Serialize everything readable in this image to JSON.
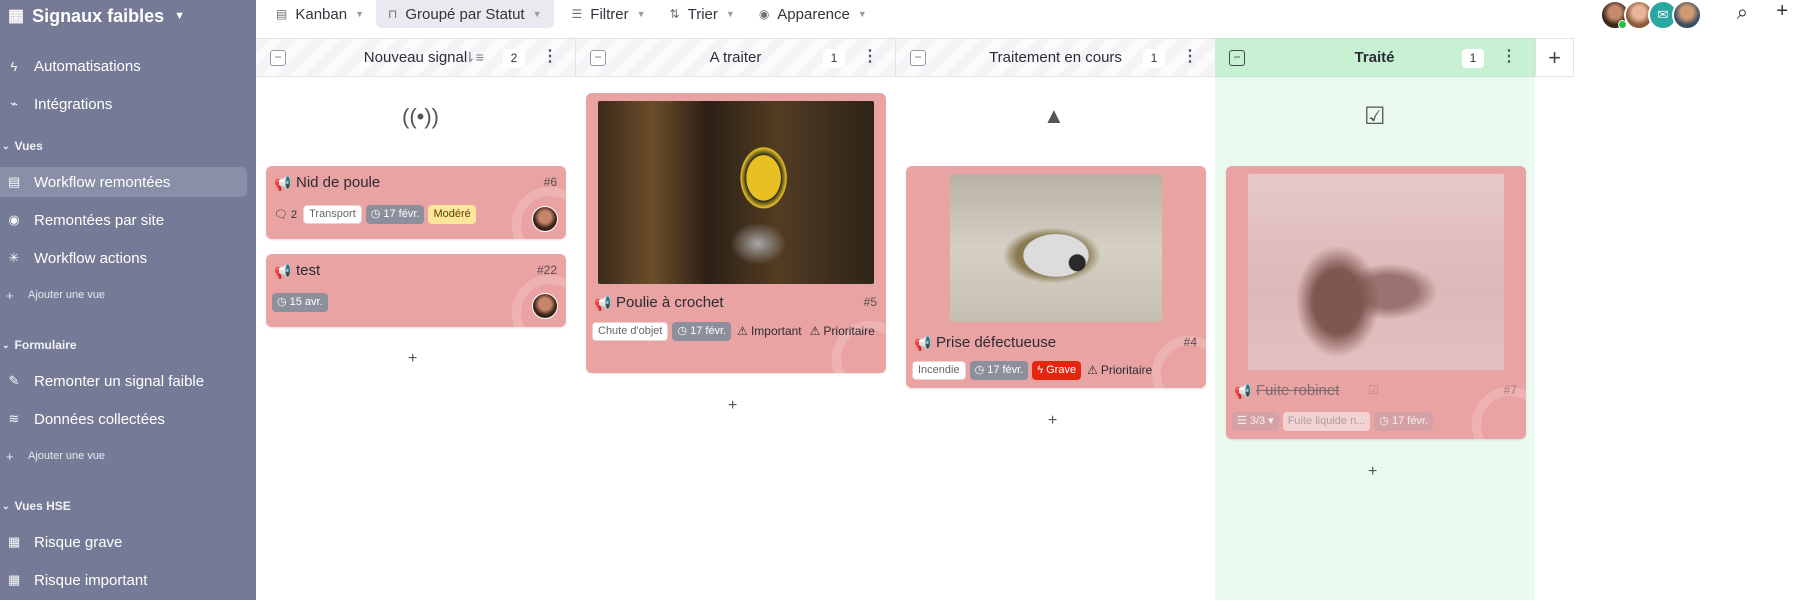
{
  "sidebar": {
    "title": "Signaux faibles",
    "items": {
      "automatisations": "Automatisations",
      "integrations": "Intégrations",
      "section_vues": "Vues",
      "workflow_remontees": "Workflow remontées",
      "remontees_par_site": "Remontées par site",
      "workflow_actions": "Workflow actions",
      "ajouter_vue_1": "Ajouter une vue",
      "section_formulaire": "Formulaire",
      "remonter": "Remonter un signal faible",
      "donnees": "Données collectées",
      "ajouter_vue_2": "Ajouter une vue",
      "section_vues_hse": "Vues HSE",
      "risque_grave": "Risque grave",
      "risque_important": "Risque important"
    }
  },
  "toolbar": {
    "kanban": "Kanban",
    "groupe": "Groupé par Statut",
    "filtrer": "Filtrer",
    "trier": "Trier",
    "apparence": "Apparence"
  },
  "columns": [
    {
      "title": "Nouveau signal",
      "count": "2"
    },
    {
      "title": "A traiter",
      "count": "1"
    },
    {
      "title": "Traitement en cours",
      "count": "1"
    },
    {
      "title": "Traité",
      "count": "1"
    }
  ],
  "cards": {
    "c6": {
      "title": "Nid de poule",
      "id": "#6",
      "comments": "2",
      "category": "Transport",
      "date": "17 févr.",
      "severity": "Modéré"
    },
    "c22": {
      "title": "test",
      "id": "#22",
      "date": "15 avr."
    },
    "c5": {
      "title": "Poulie à crochet",
      "id": "#5",
      "category": "Chute d'objet",
      "date": "17 févr.",
      "severity": "Important",
      "priority": "Prioritaire"
    },
    "c4": {
      "title": "Prise défectueuse",
      "id": "#4",
      "category": "Incendie",
      "date": "17 févr.",
      "severity": "Grave",
      "priority": "Prioritaire"
    },
    "c7": {
      "title": "Fuite robinet",
      "id": "#7",
      "checklist": "3/3",
      "category": "Fuite liquide n...",
      "date": "17 févr."
    }
  },
  "colors": {
    "sidebar": "#757b96",
    "card": "#eaa3a3",
    "done_header": "#c8f0d2",
    "grave": "#e5260e",
    "modere": "#fde69a"
  }
}
